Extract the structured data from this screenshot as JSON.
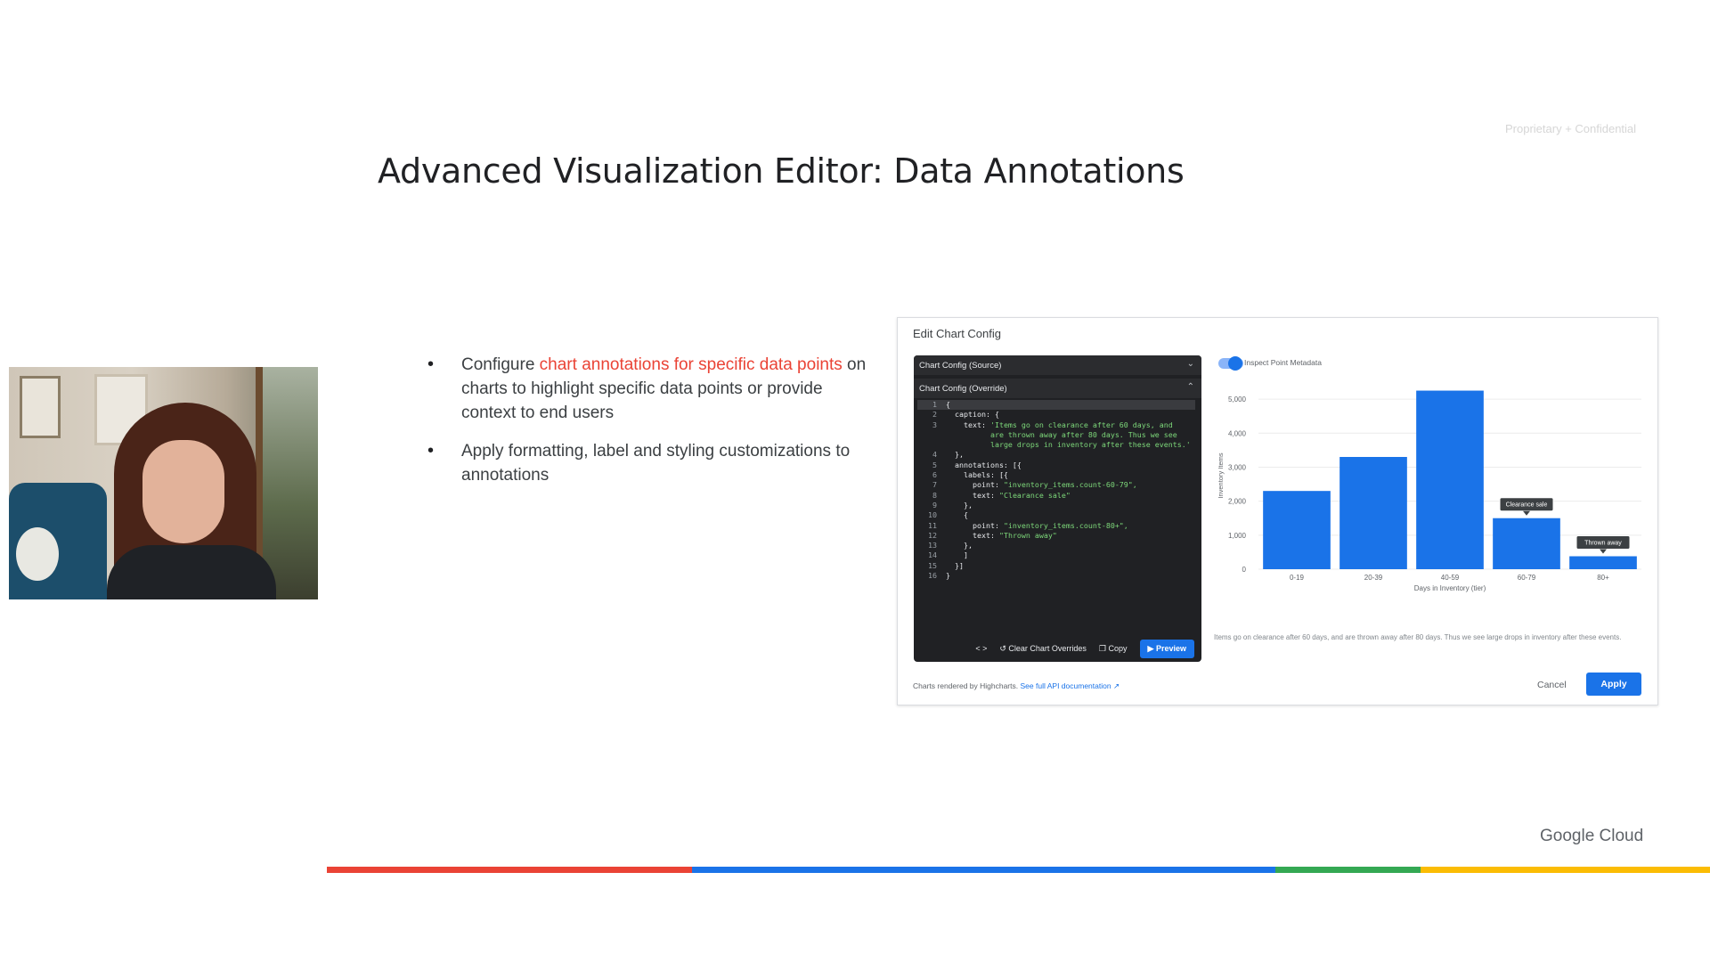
{
  "slide": {
    "confidential": "Proprietary + Confidential",
    "title": "Advanced Visualization Editor: Data Annotations",
    "bullets": [
      {
        "pre": "Configure ",
        "highlight": "chart annotations for specific data points",
        "post": " on charts to highlight specific data points or provide context to end users"
      },
      {
        "pre": "Apply formatting, label and styling customizations to annotations",
        "highlight": "",
        "post": ""
      }
    ],
    "brand": "Google Cloud",
    "colors": {
      "red": "#ea4335",
      "blue": "#1a73e8",
      "green": "#34a853",
      "yellow": "#fbbc04"
    }
  },
  "dialog": {
    "title": "Edit Chart Config",
    "source_header": "Chart Config (Source)",
    "override_header": "Chart Config (Override)",
    "code_lines": [
      {
        "n": "1",
        "code": "{",
        "str": ""
      },
      {
        "n": "2",
        "code": "  caption: {",
        "str": ""
      },
      {
        "n": "3",
        "code": "    text: ",
        "str": "'Items go on clearance after 60 days, and"
      },
      {
        "n": "",
        "code": "          ",
        "str": "are thrown away after 80 days. Thus we see"
      },
      {
        "n": "",
        "code": "          ",
        "str": "large drops in inventory after these events.'"
      },
      {
        "n": "4",
        "code": "  },",
        "str": ""
      },
      {
        "n": "5",
        "code": "  annotations: [{",
        "str": ""
      },
      {
        "n": "6",
        "code": "    labels: [{",
        "str": ""
      },
      {
        "n": "7",
        "code": "      point: ",
        "str": "\"inventory_items.count-60-79\","
      },
      {
        "n": "8",
        "code": "      text: ",
        "str": "\"Clearance sale\""
      },
      {
        "n": "9",
        "code": "    },",
        "str": ""
      },
      {
        "n": "10",
        "code": "    {",
        "str": ""
      },
      {
        "n": "11",
        "code": "      point: ",
        "str": "\"inventory_items.count-80+\","
      },
      {
        "n": "12",
        "code": "      text: ",
        "str": "\"Thrown away\""
      },
      {
        "n": "13",
        "code": "    },",
        "str": ""
      },
      {
        "n": "14",
        "code": "    ]",
        "str": ""
      },
      {
        "n": "15",
        "code": "  }]",
        "str": ""
      },
      {
        "n": "16",
        "code": "}",
        "str": ""
      }
    ],
    "toolbar": {
      "code_toggle": "< >",
      "clear_label": "Clear Chart Overrides",
      "copy_label": "Copy",
      "preview_label": "Preview"
    },
    "inspect_label": "Inspect Point Metadata",
    "caption": "Items go on clearance after 60 days, and are thrown away after 80 days. Thus we see large drops in inventory after these events.",
    "footer_note": "Charts rendered by Highcharts.",
    "footer_link": "See full API documentation",
    "cancel_label": "Cancel",
    "apply_label": "Apply"
  },
  "chart_data": {
    "type": "bar",
    "categories": [
      "0-19",
      "20-39",
      "40-59",
      "60-79",
      "80+"
    ],
    "values": [
      2300,
      3300,
      5250,
      1500,
      380
    ],
    "xlabel": "Days in Inventory (tier)",
    "ylabel": "Inventory Items",
    "yticks": [
      "0",
      "1,000",
      "2,000",
      "3,000",
      "4,000",
      "5,000"
    ],
    "ylim": [
      0,
      5500
    ],
    "color": "#1a73e8",
    "annotations": [
      {
        "category": "60-79",
        "text": "Clearance sale"
      },
      {
        "category": "80+",
        "text": "Thrown away"
      }
    ]
  }
}
